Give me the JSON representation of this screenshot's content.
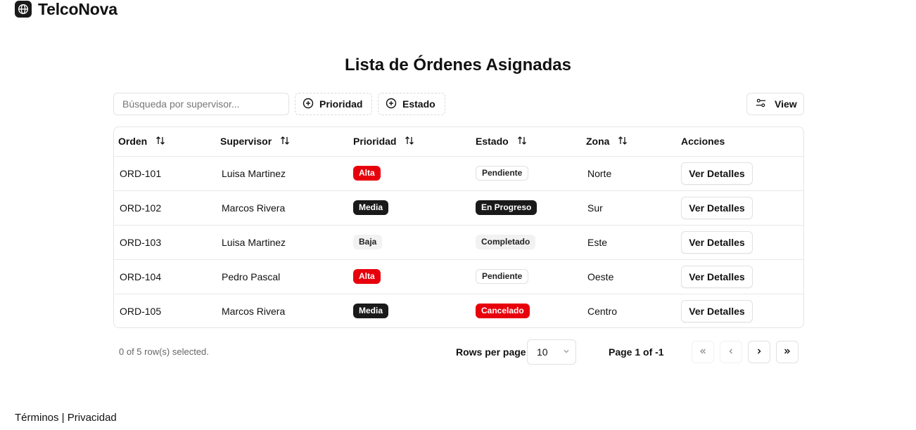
{
  "brand": {
    "name": "TelcoNova",
    "logo_icon": "globe-icon"
  },
  "page": {
    "title": "Lista de Órdenes Asignadas"
  },
  "toolbar": {
    "search_placeholder": "Búsqueda por supervisor...",
    "search_value": "",
    "filters": [
      {
        "label": "Prioridad",
        "icon": "plus-circle-icon"
      },
      {
        "label": "Estado",
        "icon": "plus-circle-icon"
      }
    ],
    "view_label": "View",
    "view_icon": "settings-sliders-icon"
  },
  "table": {
    "columns": [
      {
        "label": "Orden",
        "sortable": true
      },
      {
        "label": "Supervisor",
        "sortable": true
      },
      {
        "label": "Prioridad",
        "sortable": true
      },
      {
        "label": "Estado",
        "sortable": true
      },
      {
        "label": "Zona",
        "sortable": true
      },
      {
        "label": "Acciones",
        "sortable": false
      }
    ],
    "rows": [
      {
        "orden": "ORD-101",
        "supervisor": "Luisa Martinez",
        "prioridad": "Alta",
        "estado": "Pendiente",
        "zona": "Norte",
        "action": "Ver Detalles"
      },
      {
        "orden": "ORD-102",
        "supervisor": "Marcos Rivera",
        "prioridad": "Media",
        "estado": "En Progreso",
        "zona": "Sur",
        "action": "Ver Detalles"
      },
      {
        "orden": "ORD-103",
        "supervisor": "Luisa Martinez",
        "prioridad": "Baja",
        "estado": "Completado",
        "zona": "Este",
        "action": "Ver Detalles"
      },
      {
        "orden": "ORD-104",
        "supervisor": "Pedro Pascal",
        "prioridad": "Alta",
        "estado": "Pendiente",
        "zona": "Oeste",
        "action": "Ver Detalles"
      },
      {
        "orden": "ORD-105",
        "supervisor": "Marcos Rivera",
        "prioridad": "Media",
        "estado": "Cancelado",
        "zona": "Centro",
        "action": "Ver Detalles"
      }
    ]
  },
  "badge_colors": {
    "Alta": "#e7000b",
    "Media": "#1a1a1a",
    "Baja": "#f2f2f2",
    "Pendiente": "#ffffff",
    "En Progreso": "#1a1a1a",
    "Completado": "#f2f2f2",
    "Cancelado": "#e7000b"
  },
  "pagination": {
    "selected_text": "0 of 5 row(s) selected.",
    "rows_per_page_label": "Rows per page",
    "rows_per_page_value": "10",
    "page_label": "Page 1 of -1"
  },
  "footer": {
    "legal_text": "Términos | Privacidad"
  }
}
